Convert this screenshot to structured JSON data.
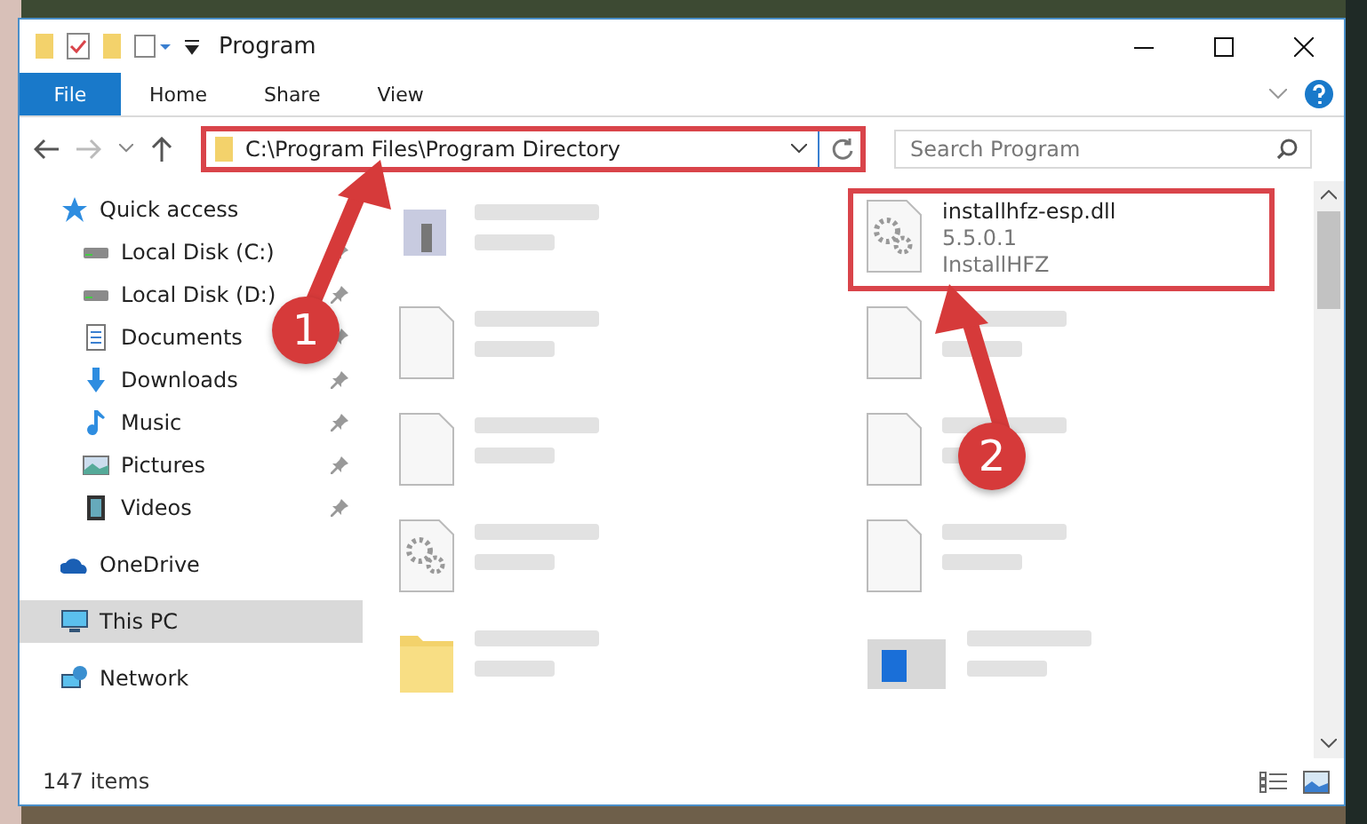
{
  "window": {
    "title": "Program"
  },
  "ribbon_tabs": [
    {
      "label": "File",
      "selected": true
    },
    {
      "label": "Home",
      "selected": false
    },
    {
      "label": "Share",
      "selected": false
    },
    {
      "label": "View",
      "selected": false
    }
  ],
  "address": {
    "path": "C:\\Program Files\\Program Directory",
    "highlighted": true
  },
  "search": {
    "placeholder": "Search Program"
  },
  "sidebar": {
    "items": [
      {
        "label": "Quick access",
        "kind": "star",
        "pinned": false,
        "selected": false,
        "children": [
          {
            "label": "Local Disk (C:)",
            "kind": "disk",
            "pinned": true,
            "selected": false
          },
          {
            "label": "Local Disk (D:)",
            "kind": "disk",
            "pinned": true,
            "selected": false
          },
          {
            "label": "Documents",
            "kind": "doc",
            "pinned": true,
            "selected": false
          },
          {
            "label": "Downloads",
            "kind": "download",
            "pinned": true,
            "selected": false
          },
          {
            "label": "Music",
            "kind": "music",
            "pinned": true,
            "selected": false
          },
          {
            "label": "Pictures",
            "kind": "pictures",
            "pinned": true,
            "selected": false
          },
          {
            "label": "Videos",
            "kind": "videos",
            "pinned": true,
            "selected": false
          }
        ]
      },
      {
        "label": "OneDrive",
        "kind": "cloud",
        "pinned": false,
        "selected": false
      },
      {
        "label": "This PC",
        "kind": "pc",
        "pinned": false,
        "selected": true
      },
      {
        "label": "Network",
        "kind": "network",
        "pinned": false,
        "selected": false
      }
    ]
  },
  "files": [
    {
      "kind": "exe",
      "highlighted": false,
      "blurred": true
    },
    {
      "kind": "dll",
      "name": "installhfz-esp.dll",
      "lines": [
        "5.5.0.1",
        "InstallHFZ"
      ],
      "highlighted": true,
      "blurred": false
    },
    {
      "kind": "blank",
      "highlighted": false,
      "blurred": true
    },
    {
      "kind": "blank",
      "highlighted": false,
      "blurred": true
    },
    {
      "kind": "blank",
      "highlighted": false,
      "blurred": true
    },
    {
      "kind": "blank",
      "highlighted": false,
      "blurred": true
    },
    {
      "kind": "dll",
      "highlighted": false,
      "blurred": true
    },
    {
      "kind": "blank",
      "highlighted": false,
      "blurred": true
    },
    {
      "kind": "folder",
      "highlighted": false,
      "blurred": true
    },
    {
      "kind": "installer",
      "highlighted": false,
      "blurred": true
    }
  ],
  "status_bar": {
    "count": "147 items"
  },
  "annotations": [
    {
      "number": "1"
    },
    {
      "number": "2"
    }
  ]
}
